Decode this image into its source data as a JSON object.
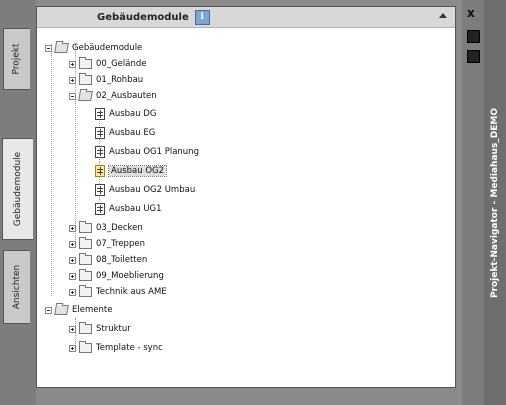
{
  "left_tabs": [
    {
      "label": "Projekt"
    },
    {
      "label": "Gebäudemodule"
    },
    {
      "label": "Ansichten"
    }
  ],
  "panel": {
    "title": "Gebäudemodule",
    "info_icon": "i"
  },
  "tree": [
    {
      "label": "Gebäudemodule"
    },
    {
      "label": "00_Gelände"
    },
    {
      "label": "01_Rohbau"
    },
    {
      "label": "02_Ausbauten"
    },
    {
      "label": "Ausbau DG"
    },
    {
      "label": "Ausbau EG"
    },
    {
      "label": "Ausbau OG1 Planung"
    },
    {
      "label": "Ausbau OG2"
    },
    {
      "label": "Ausbau OG2 Umbau"
    },
    {
      "label": "Ausbau UG1"
    },
    {
      "label": "03_Decken"
    },
    {
      "label": "07_Treppen"
    },
    {
      "label": "08_Toiletten"
    },
    {
      "label": "09_Moeblierung"
    },
    {
      "label": "Technik aus AME"
    },
    {
      "label": "Elemente"
    },
    {
      "label": "Struktur"
    },
    {
      "label": "Template - sync"
    }
  ],
  "right_panel": {
    "close_glyph": "x",
    "vertical_title": "Projekt-Navigator - Mediahaus_DEMO"
  },
  "colors": {
    "panel_bg": "#ffffff",
    "chrome": "#7d7d7d",
    "title_bar": "#6e6e6e"
  }
}
